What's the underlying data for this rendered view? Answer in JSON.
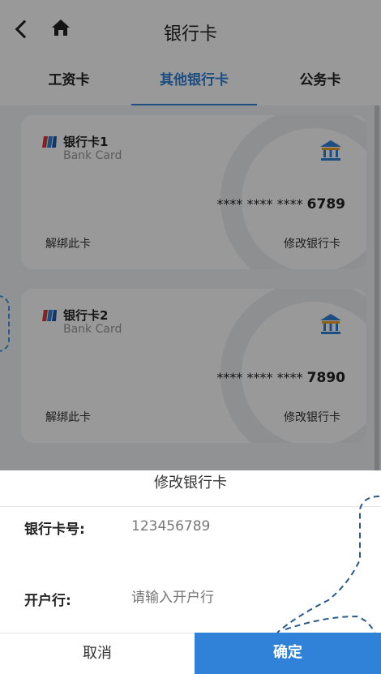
{
  "header": {
    "title": "银行卡"
  },
  "tabs": [
    {
      "label": "工资卡"
    },
    {
      "label": "其他银行卡"
    },
    {
      "label": "公务卡"
    }
  ],
  "cards": [
    {
      "title": "银行卡1",
      "subtitle": "Bank Card",
      "masked": "**** **** ****",
      "last4": "6789",
      "unbind": "解绑此卡",
      "edit": "修改银行卡"
    },
    {
      "title": "银行卡2",
      "subtitle": "Bank Card",
      "masked": "**** **** ****",
      "last4": "7890",
      "unbind": "解绑此卡",
      "edit": "修改银行卡"
    }
  ],
  "dialog": {
    "title": "修改银行卡",
    "card_number_label": "银行卡号:",
    "card_number_value": "123456789",
    "bank_label": "开户行:",
    "bank_placeholder": "请输入开户行",
    "cancel": "取消",
    "confirm": "确定"
  },
  "colors": {
    "accent": "#2f82d8",
    "background": "#f2f3f5",
    "overlay": "rgba(0,0,0,0.40)"
  },
  "icons": {
    "back": "chevron-left-icon",
    "home": "home-icon",
    "bank": "bank-icon",
    "card": "card-flag-icon"
  }
}
